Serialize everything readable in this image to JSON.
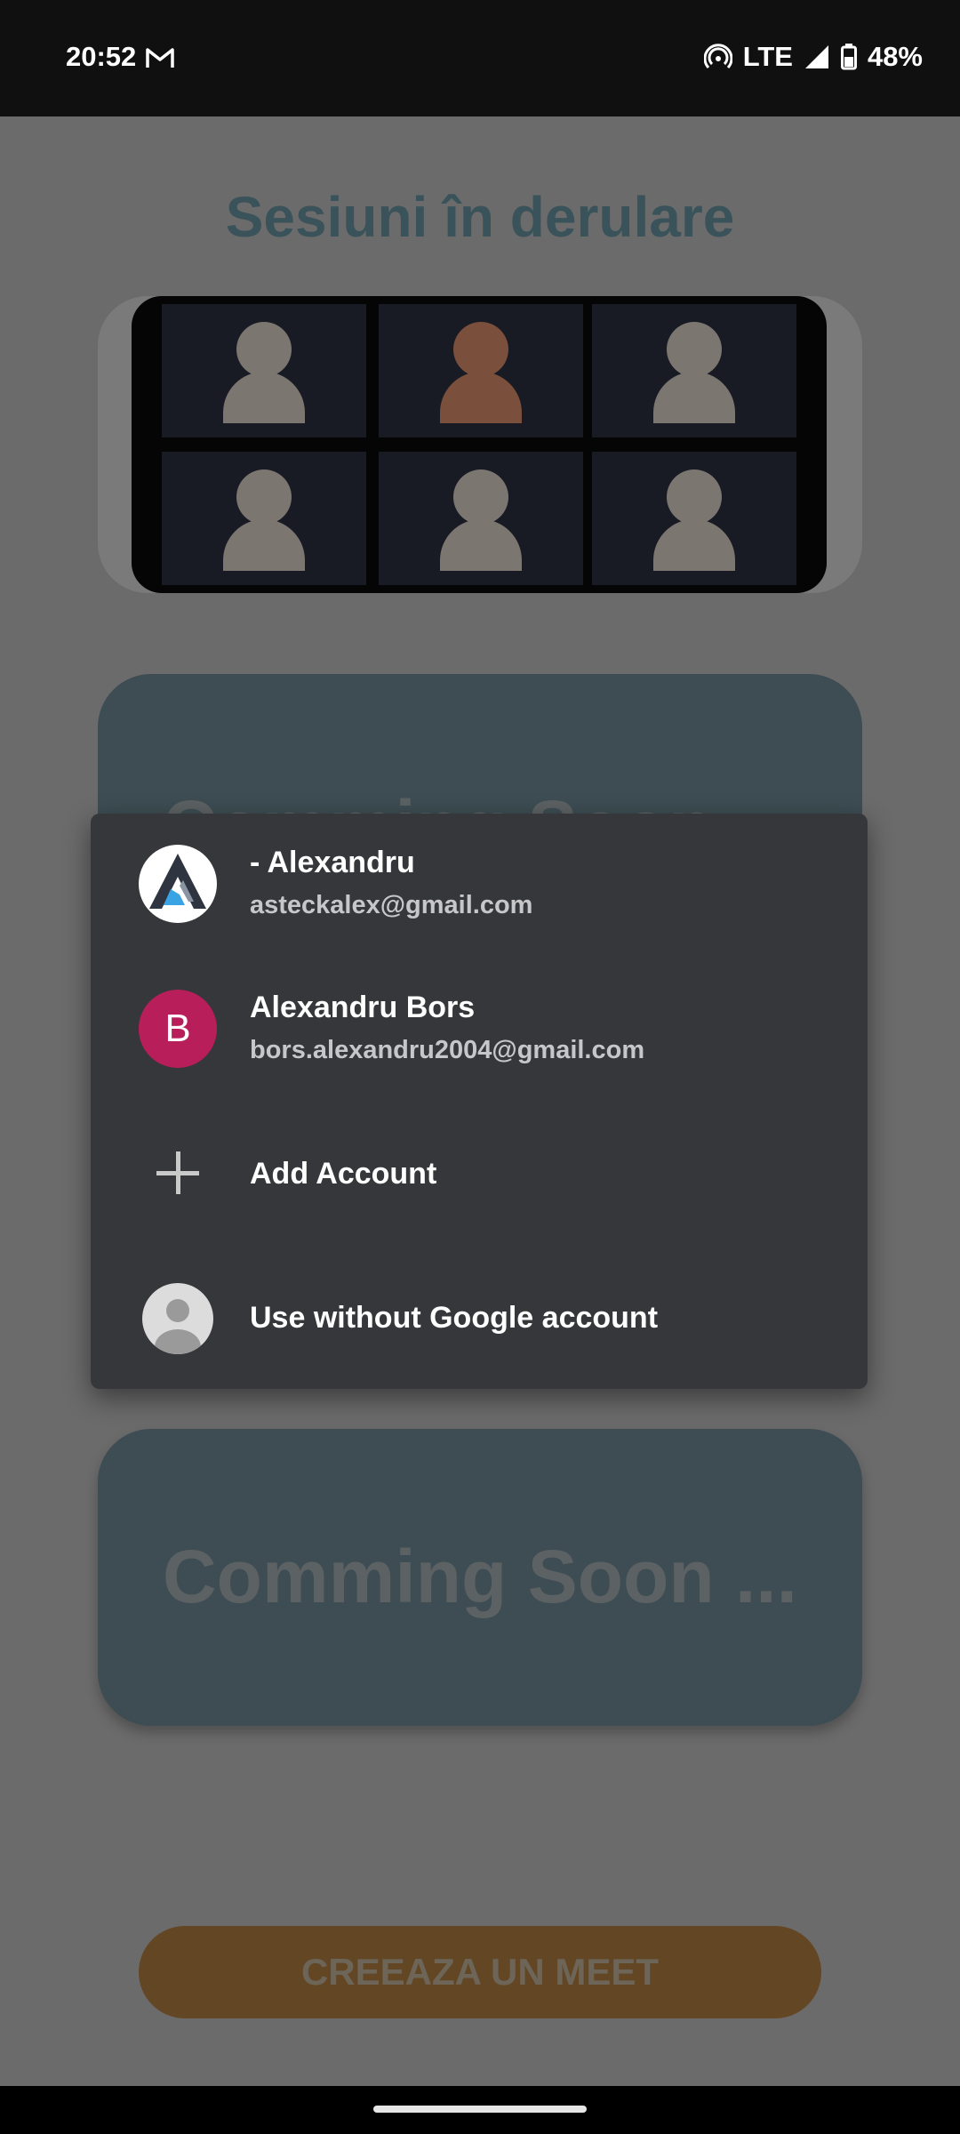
{
  "status_bar": {
    "time": "20:52",
    "network": "LTE",
    "battery": "48%"
  },
  "page": {
    "title": "Sesiuni în derulare",
    "coming_soon_1": "Comming Soon ...",
    "coming_soon_2": "Comming Soon ...",
    "create_button": "CREEAZA UN MEET"
  },
  "account_dialog": {
    "accounts": [
      {
        "name": "- Alexandru",
        "email": "asteckalex@gmail.com",
        "avatar": "logo-icon"
      },
      {
        "name": "Alexandru Bors",
        "email": "bors.alexandru2004@gmail.com",
        "avatar_letter": "B",
        "avatar_color": "#b81e5a"
      }
    ],
    "add_account": "Add Account",
    "use_without": "Use without Google account"
  }
}
